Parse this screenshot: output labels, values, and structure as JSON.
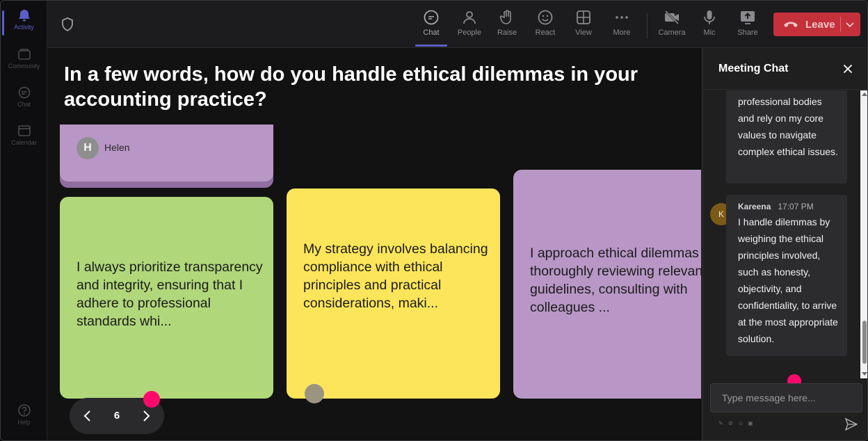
{
  "rail": {
    "items": [
      {
        "label": "Activity",
        "icon": "bell-icon",
        "active": true
      },
      {
        "label": "Community",
        "icon": "community-icon",
        "active": false
      },
      {
        "label": "Chat",
        "icon": "chat-icon",
        "active": false
      },
      {
        "label": "Calendar",
        "icon": "calendar-icon",
        "active": false
      },
      {
        "label": "Help",
        "icon": "help-icon",
        "active": false
      }
    ]
  },
  "toolbar": {
    "items": [
      {
        "label": "Chat",
        "icon": "chat-icon"
      },
      {
        "label": "People",
        "icon": "people-icon"
      },
      {
        "label": "Raise",
        "icon": "raise-hand-icon"
      },
      {
        "label": "React",
        "icon": "react-icon"
      },
      {
        "label": "View",
        "icon": "view-icon"
      },
      {
        "label": "More",
        "icon": "more-icon"
      },
      {
        "label": "Camera",
        "icon": "camera-off-icon"
      },
      {
        "label": "Mic",
        "icon": "mic-icon"
      },
      {
        "label": "Share",
        "icon": "share-icon"
      }
    ],
    "leave_label": "Leave",
    "leave_color": "#c4313b",
    "accent_color": "#5b5fc7"
  },
  "board": {
    "question": "In a few words, how do you handle ethical dilemmas in your accounting practice?",
    "cards": [
      {
        "author_initial": "H",
        "author_name": "Helen",
        "color": "#b897c6"
      },
      {
        "text": "I always prioritize transparency and integrity, ensuring that I adhere to professional standards whi...",
        "color": "#b0d77a"
      },
      {
        "text": "My strategy involves balancing compliance with ethical principles and practical considerations, maki...",
        "color": "#fce55a"
      },
      {
        "text": "I approach ethical dilemmas by thoroughly reviewing relevant guidelines, consulting with colleagues ...",
        "color": "#b897c6"
      }
    ],
    "page_number": "6"
  },
  "chat": {
    "title": "Meeting Chat",
    "messages": [
      {
        "text": "professional bodies and rely on my core values to navigate complex ethical issues."
      },
      {
        "author": "Kareena",
        "author_initial": "K",
        "time": "17:07 PM",
        "text": "I handle dilemmas by weighing the ethical principles involved, such as honesty, objectivity, and confidentiality, to arrive at the most appropriate solution."
      }
    ],
    "input_placeholder": "Type message here..."
  }
}
